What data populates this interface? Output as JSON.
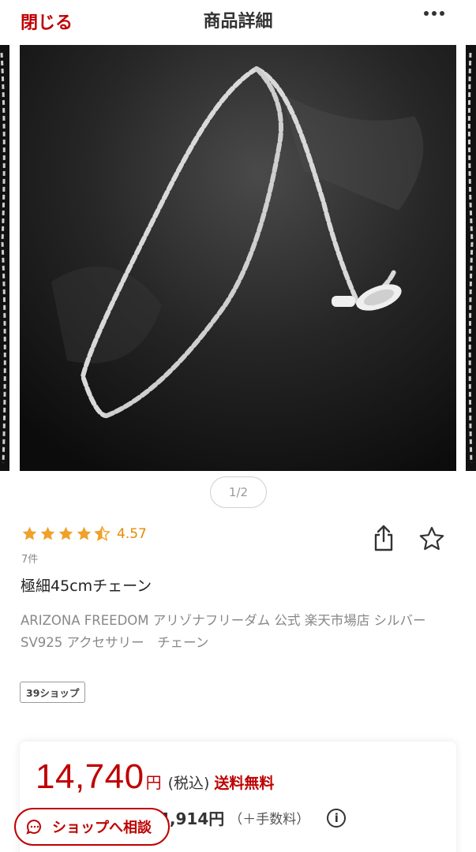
{
  "header": {
    "close_label": "閉じる",
    "title": "商品詳細",
    "more_icon": "more-horizontal-icon"
  },
  "gallery": {
    "pager": "1/2",
    "image_subject": "silver-chain-necklace"
  },
  "rating": {
    "value": "4.57",
    "stars": 4.5,
    "count": "7件",
    "star_color": "#f0a12a"
  },
  "actions": {
    "share_icon": "share-icon",
    "favorite_icon": "star-outline-icon"
  },
  "product": {
    "name": "極細45cmチェーン",
    "description": "ARIZONA FREEDOM アリゾナフリーダム 公式 楽天市場店 シルバー SV925 アクセサリー　チェーン",
    "shop_badge": "39ショップ"
  },
  "price": {
    "value": "14,740",
    "unit": "円",
    "tax_label": "(税込)",
    "shipping_label": "送料無料",
    "sub_price": "4,914円",
    "sub_fee": "（＋手数料）",
    "accent_color": "#bf0000"
  },
  "consult": {
    "label": "ショップへ相談"
  }
}
